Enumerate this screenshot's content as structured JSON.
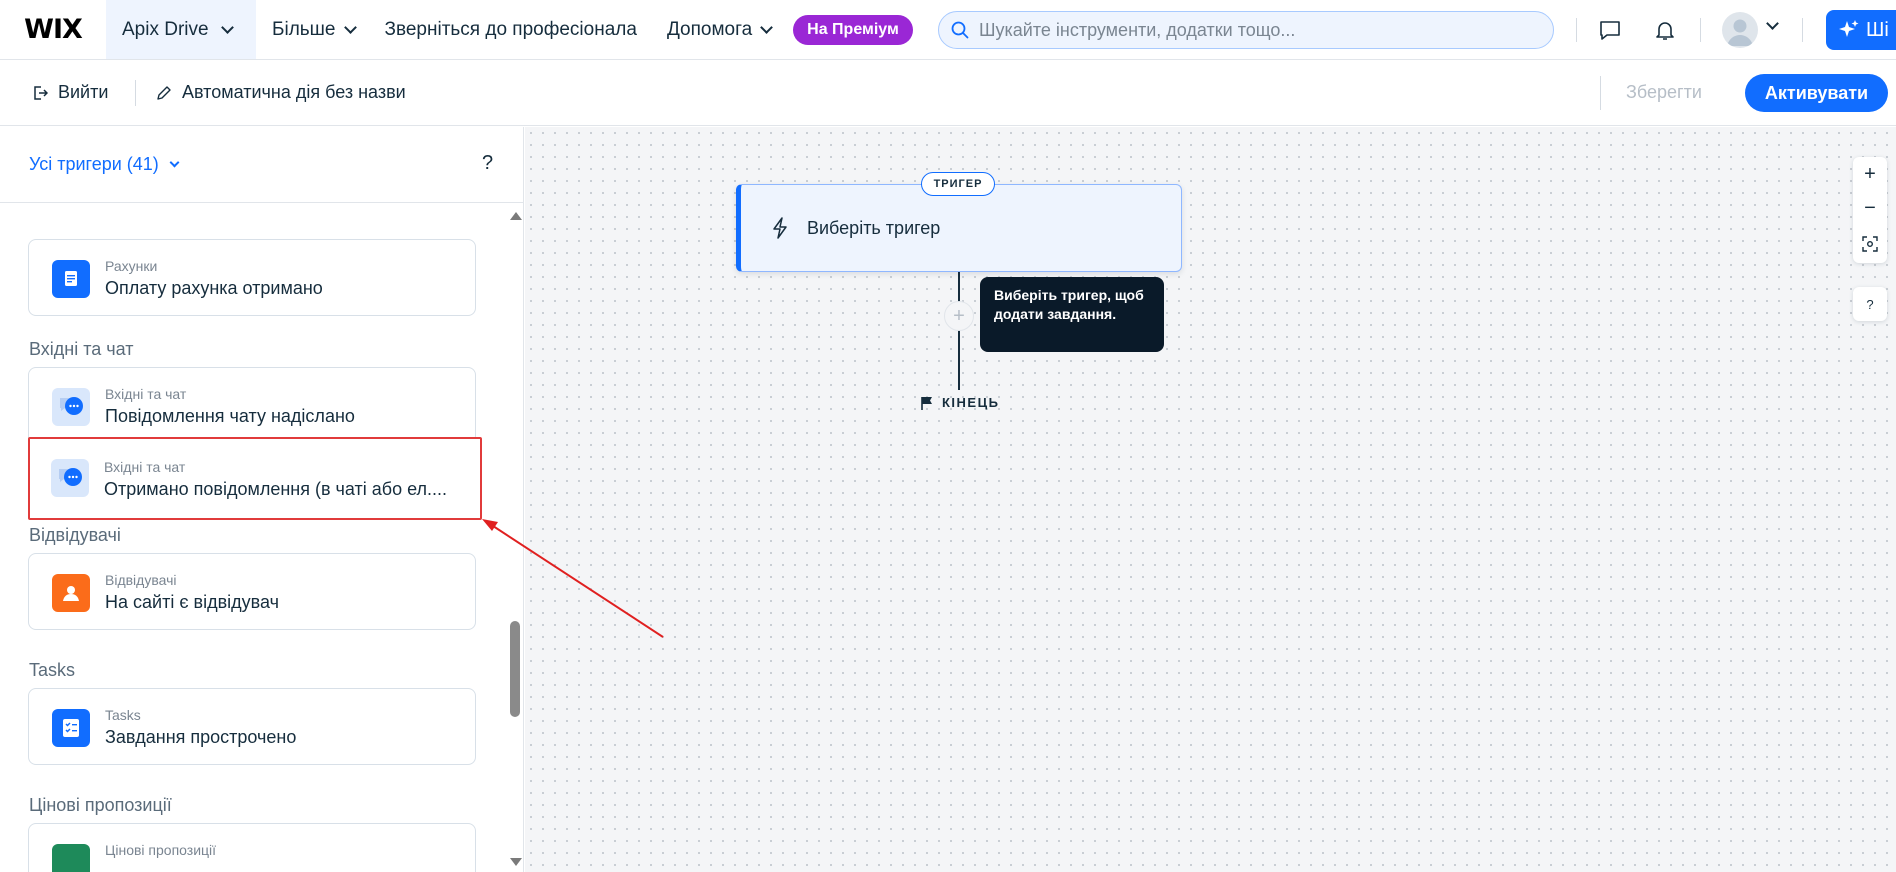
{
  "topbar": {
    "logo": "WIX",
    "site_name": "Apix Drive",
    "nav": [
      "Більше",
      "Зверніться до професіонала",
      "Допомога"
    ],
    "premium_label": "На Преміум",
    "search_placeholder": "Шукайте інструменти, додатки тощо...",
    "ai_label": "Ші"
  },
  "toolbar": {
    "exit_label": "Вийти",
    "automation_name": "Автоматична дія без назви",
    "save_label": "Зберегти",
    "activate_label": "Активувати"
  },
  "sidebar": {
    "filter_label": "Усі тригери (41)",
    "help": "?",
    "sections": [
      {
        "title": "",
        "cards": [
          {
            "category": "Рахунки",
            "title": "Оплату рахунка отримано",
            "icon": "invoice-icon"
          }
        ]
      },
      {
        "title": "Вхідні та чат",
        "cards": [
          {
            "category": "Вхідні та чат",
            "title": "Повідомлення чату надіслано",
            "icon": "chat-icon"
          },
          {
            "category": "Вхідні та чат",
            "title": "Отримано повідомлення (в чаті або ел....",
            "icon": "chat-icon",
            "selected": true
          }
        ]
      },
      {
        "title": "Відвідувачі",
        "cards": [
          {
            "category": "Відвідувачі",
            "title": "На сайті є відвідувач",
            "icon": "visitor-icon"
          }
        ]
      },
      {
        "title": "Tasks",
        "cards": [
          {
            "category": "Tasks",
            "title": "Завдання прострочено",
            "icon": "tasks-icon"
          }
        ]
      },
      {
        "title": "Цінові пропозиції",
        "cards": [
          {
            "category": "Цінові пропозиції",
            "title": "",
            "icon": "quote-icon"
          }
        ]
      }
    ]
  },
  "canvas": {
    "trigger_tag": "ТРИГЕР",
    "trigger_label": "Виберіть тригер",
    "plus": "+",
    "tooltip": "Виберіть тригер, щоб додати завдання.",
    "end_label": "КІНЕЦЬ",
    "zoom_in": "+",
    "zoom_out": "−",
    "help": "?"
  },
  "colors": {
    "accent": "#116dff",
    "premium": "#9a27d5",
    "highlight": "#e13b3b",
    "tooltip_bg": "#0a1a29"
  }
}
